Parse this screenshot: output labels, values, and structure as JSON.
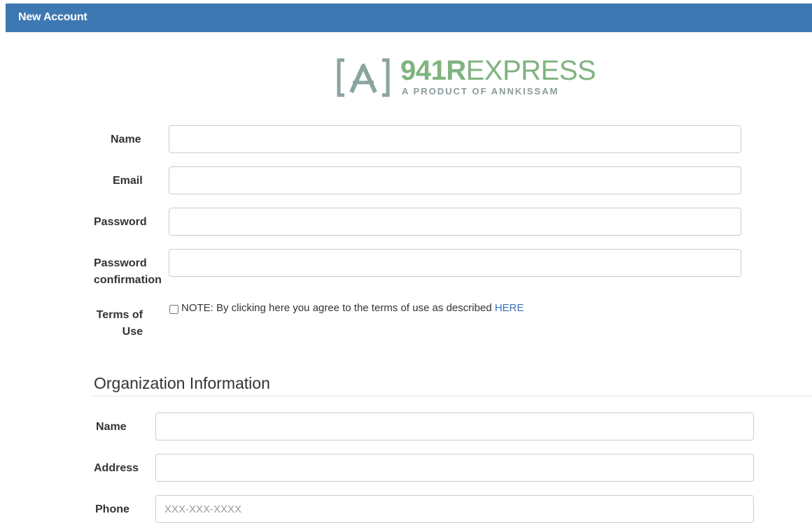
{
  "header": {
    "title": "New Account"
  },
  "logo": {
    "bracket_letter": "A",
    "name_bold": "941R",
    "name_light": "EXPRESS",
    "tagline": "A PRODUCT OF ANNKISSAM",
    "colors": {
      "green": "#7fb37f",
      "gray": "#8a9a9a",
      "bracket": "#8aa4a0"
    }
  },
  "account": {
    "name_label": "Name",
    "email_label": "Email",
    "password_label": "Password",
    "password_confirmation_label_line1": "Password",
    "password_confirmation_label_line2": "confirmation",
    "terms_label_line1": "Terms of",
    "terms_label_line2": "Use",
    "terms_note": "NOTE: By clicking here you agree to the terms of use as described ",
    "terms_link": "HERE"
  },
  "organization": {
    "heading": "Organization Information",
    "name_label": "Name",
    "address_label": "Address",
    "phone_label": "Phone",
    "phone_placeholder": "XXX-XXX-XXXX"
  },
  "colors": {
    "header_bg": "#3e78b2",
    "link": "#3a73b6"
  }
}
